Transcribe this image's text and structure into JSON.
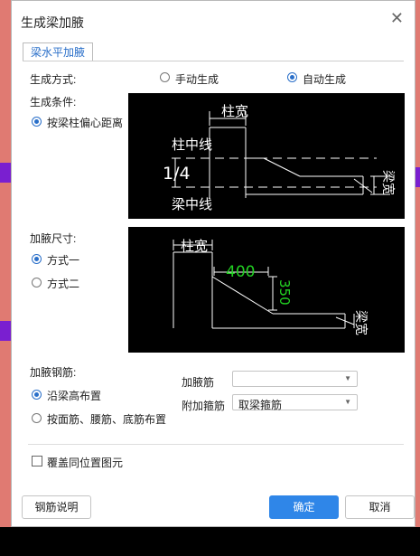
{
  "window": {
    "title": "生成梁加腋"
  },
  "tab": {
    "label": "梁水平加腋"
  },
  "gen_mode": {
    "label": "生成方式:",
    "manual": "手动生成",
    "auto": "自动生成",
    "selected": "auto"
  },
  "gen_condition": {
    "label": "生成条件:",
    "option": "按梁柱偏心距离"
  },
  "diagram1": {
    "col_width": "柱宽",
    "col_center": "柱中线",
    "ratio": "1/4",
    "beam_center": "梁中线",
    "beam_width": "梁宽"
  },
  "haunch_size": {
    "label": "加腋尺寸:",
    "option1": "方式一",
    "option2": "方式二",
    "selected": "option1"
  },
  "diagram2": {
    "col_width": "柱宽",
    "dim_h": "400",
    "dim_v": "350",
    "beam_width": "梁宽"
  },
  "rebar": {
    "label": "加腋钢筋:",
    "opt1": "沿梁高布置",
    "opt2": "按面筋、腰筋、底筋布置",
    "selected": "opt1",
    "haunch_bar_label": "加腋筋",
    "haunch_bar_value": "",
    "stirrup_label": "附加箍筋",
    "stirrup_value": "取梁箍筋"
  },
  "overwrite": {
    "label": "覆盖同位置图元",
    "checked": false
  },
  "buttons": {
    "help": "钢筋说明",
    "ok": "确定",
    "cancel": "取消"
  }
}
